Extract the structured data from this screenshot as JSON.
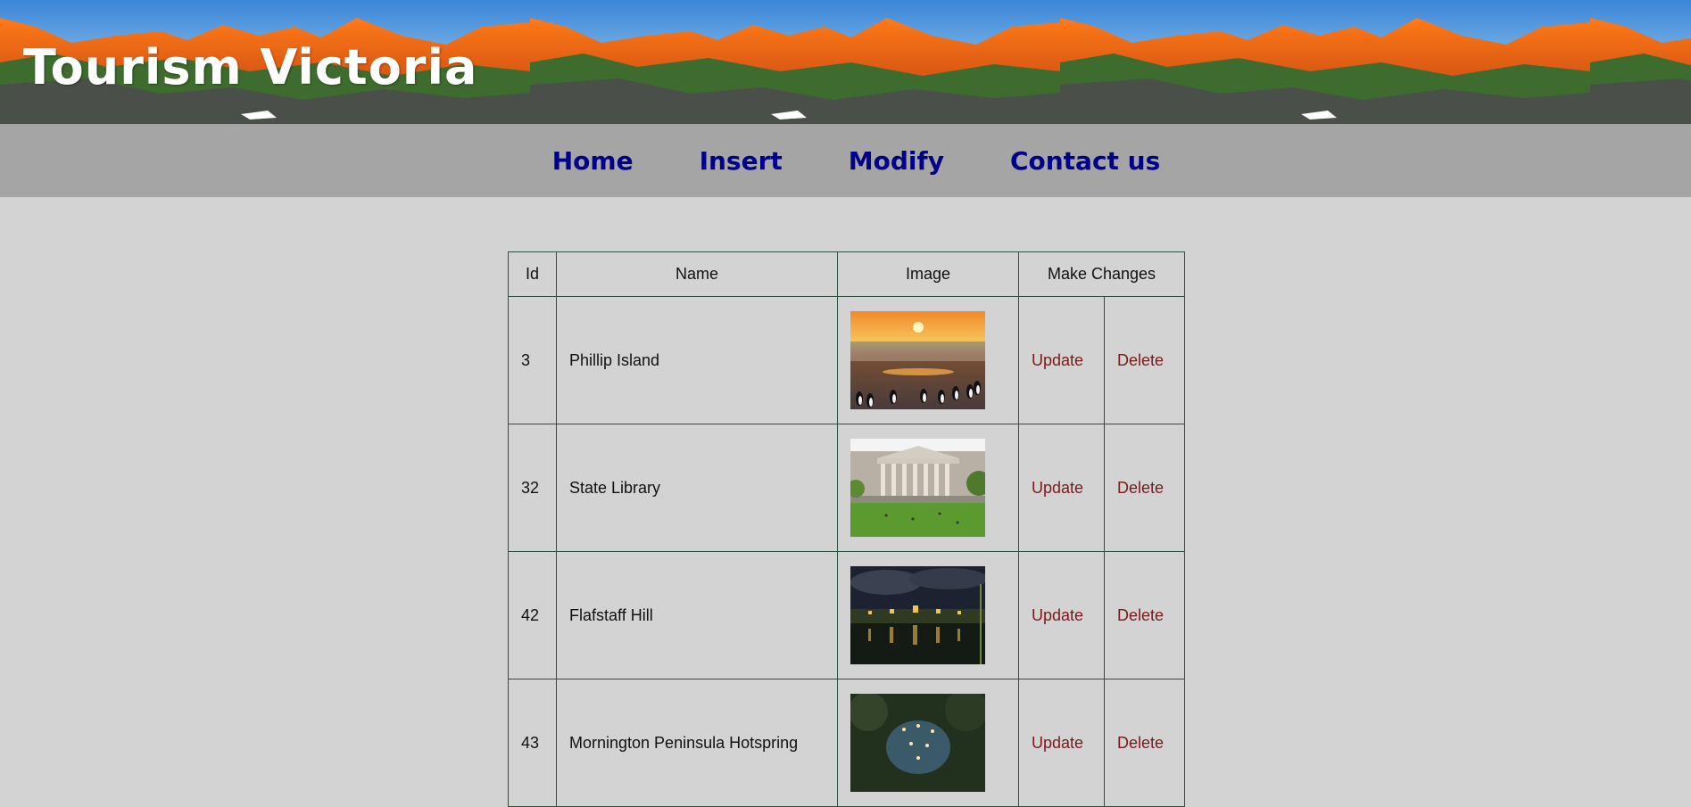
{
  "header": {
    "title": "Tourism Victoria"
  },
  "nav": {
    "items": [
      {
        "label": "Home"
      },
      {
        "label": "Insert"
      },
      {
        "label": "Modify"
      },
      {
        "label": "Contact us"
      }
    ]
  },
  "table": {
    "headers": {
      "id": "Id",
      "name": "Name",
      "image": "Image",
      "changes": "Make Changes"
    },
    "rows": [
      {
        "id": "3",
        "name": "Phillip Island",
        "image": "beach-sunset-penguins-photo",
        "update": "Update",
        "delete": "Delete"
      },
      {
        "id": "32",
        "name": "State Library",
        "image": "state-library-building-photo",
        "update": "Update",
        "delete": "Delete"
      },
      {
        "id": "42",
        "name": "Flafstaff Hill",
        "image": "night-village-reflection-photo",
        "update": "Update",
        "delete": "Delete"
      },
      {
        "id": "43",
        "name": "Mornington Peninsula Hotspring",
        "image": "hot-springs-night-photo",
        "update": "Update",
        "delete": "Delete"
      }
    ]
  },
  "colors": {
    "page_bg": "#d3d3d3",
    "nav_bg": "#a5a5a5",
    "nav_link": "#00008b",
    "action_link": "#7a1a1a",
    "table_border": "#2f4f3f"
  }
}
